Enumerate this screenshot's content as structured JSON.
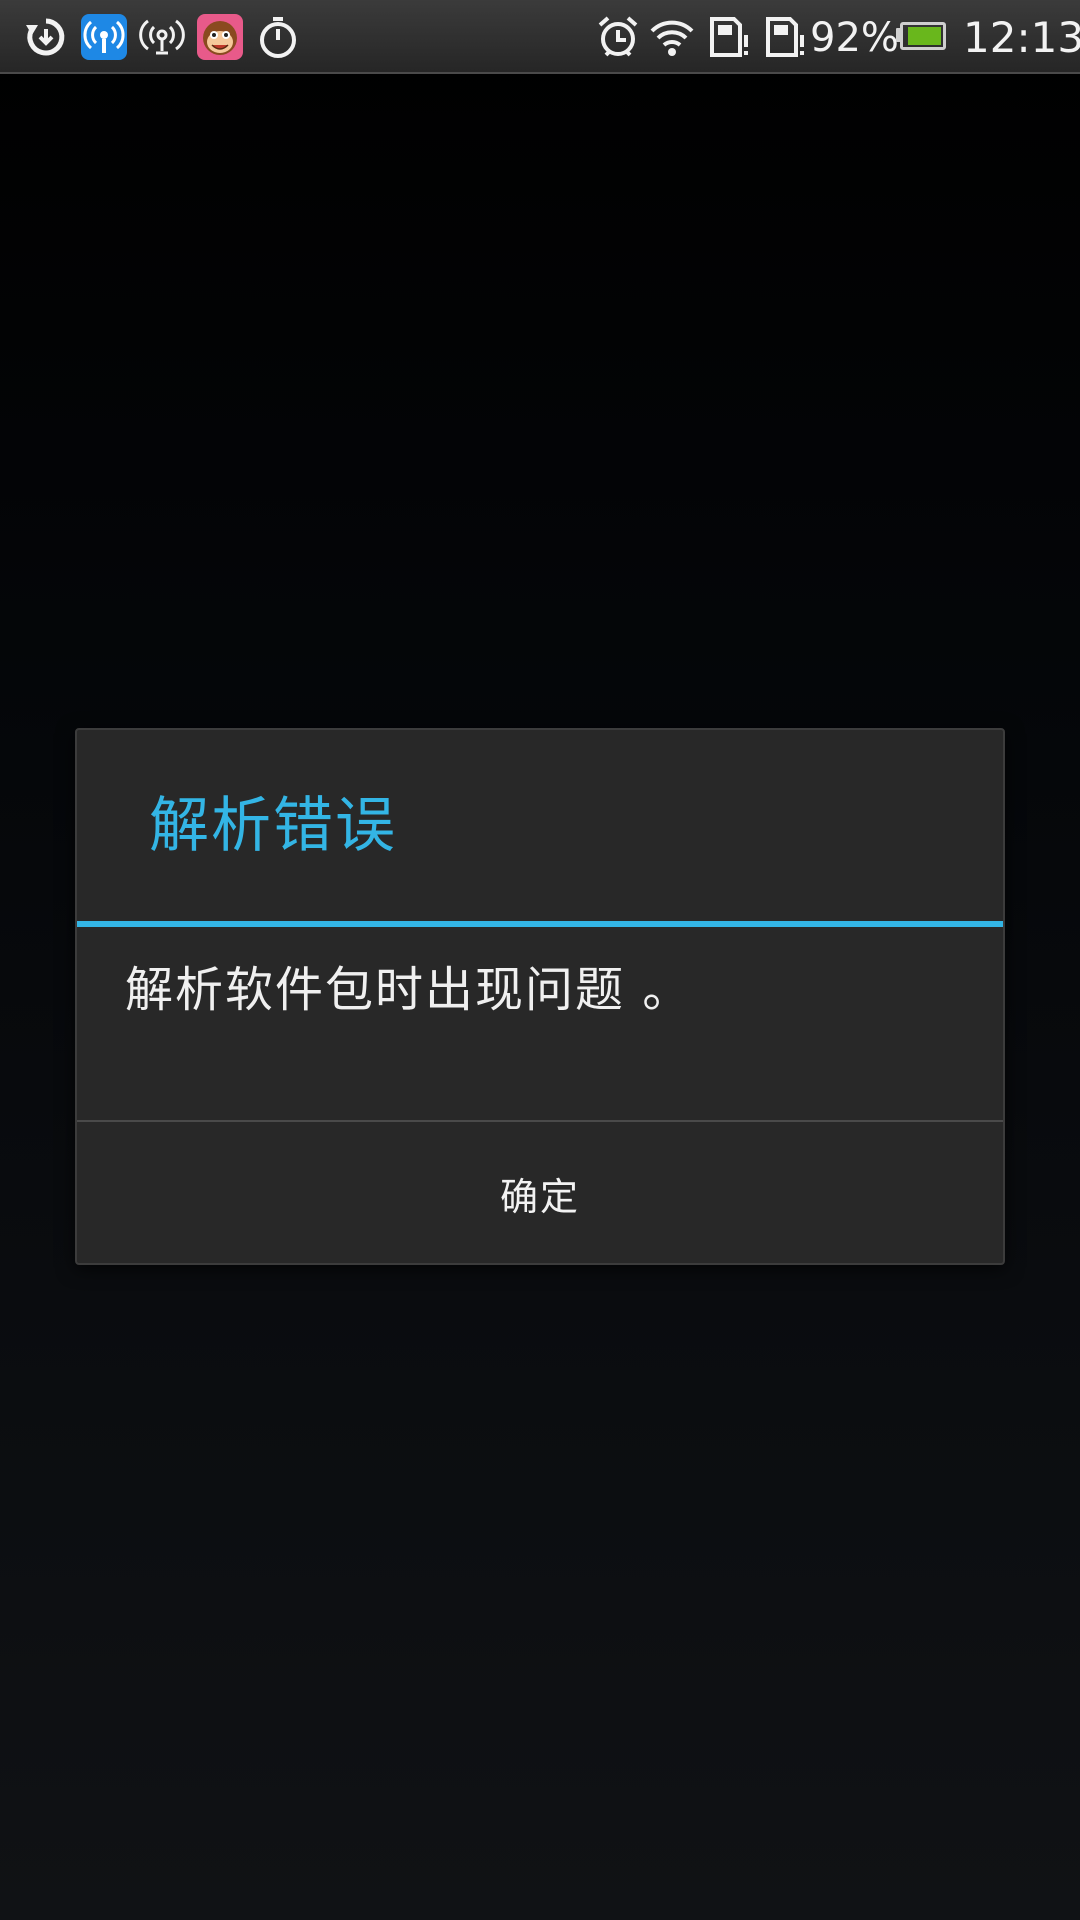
{
  "status_bar": {
    "left_icons": [
      "sync-icon",
      "wifi-hotspot-app-icon",
      "hotspot-icon",
      "monkey-app-icon",
      "stopwatch-icon"
    ],
    "right_icons": [
      "alarm-icon",
      "wifi-signal-icon",
      "sd-card-alert-icon",
      "sd-card-alert-icon-2"
    ],
    "battery_percent": "92%",
    "battery_level": 0.92,
    "time": "12:13",
    "colors": {
      "accent_app_blue": "#1e88e5",
      "battery_green": "#69b71c"
    }
  },
  "dialog": {
    "title": "解析错误",
    "message": "解析软件包时出现问题 。",
    "ok_label": "确定",
    "accent_color": "#33b5e5"
  }
}
